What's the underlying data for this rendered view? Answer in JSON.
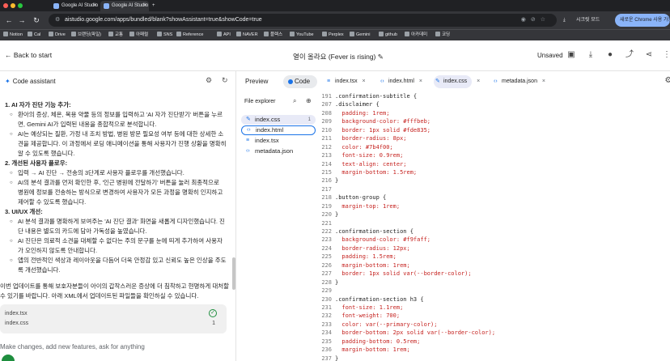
{
  "browser": {
    "tabs": [
      "Google AI Studio",
      "Google AI Studio"
    ],
    "url": "aistudio.google.com/apps/bundled/blank?showAssistant=true&showCode=true",
    "secret_mode": "시크릿 모드",
    "chrome_ad": "새로운 Chrome 사용 가능",
    "bookmarks": [
      "Notion",
      "Cal",
      "Drive",
      "브랜딩(파일)",
      "교통",
      "아패럴",
      "SNS",
      "Reference",
      "API",
      "NAVER",
      "플렉스",
      "YouTube",
      "Perplex",
      "Gemini",
      "github",
      "아카데미",
      "코딩"
    ]
  },
  "appbar": {
    "back_label": "Back to start",
    "title": "열이 올라요 (Fever is rising)",
    "unsaved": "Unsaved"
  },
  "assistant": {
    "title": "Code assistant",
    "lines": [
      {
        "kind": "h",
        "text": "1. AI 자가 진단 기능 추가:"
      },
      {
        "kind": "s",
        "text": "환아의 증상, 체온, 복용 약물 등의 정보를 입력하고 'AI 자가 진단받기' 버튼을 누르"
      },
      {
        "kind": "c",
        "text": "면, Gemini AI가 입력된 내용을 종합적으로 분석합니다."
      },
      {
        "kind": "s",
        "text": "AI는 예상되는 질환, 가정 내 조치 방법, 병원 방문 필요성 여부 등에 대한 상세한 소"
      },
      {
        "kind": "c",
        "text": "견을 제공합니다. 이 과정에서 로딩 애니메이션을 통해 사용자가 진행 상황을 명확히"
      },
      {
        "kind": "c",
        "text": "알 수 있도록 했습니다."
      },
      {
        "kind": "h",
        "text": "2. 개선된 사용자 플로우:"
      },
      {
        "kind": "s",
        "text": "입력 → AI 진단 → 전송의 3단계로 사용자 플로우를 개선했습니다."
      },
      {
        "kind": "s",
        "text": "AI의 분석 결과를 먼저 확인한 후, '인근 병원에 전달하기' 버튼을 눌러 최종적으로"
      },
      {
        "kind": "c",
        "text": "병원에 정보를 전송하는 방식으로 변경하여 사용자가 모든 과정을 명확히 인지하고"
      },
      {
        "kind": "c",
        "text": "제어할 수 있도록 했습니다."
      },
      {
        "kind": "h",
        "text": "3. UI/UX 개선:"
      },
      {
        "kind": "s",
        "text": "AI 분석 결과를 명확하게 보여주는 'AI 진단 결과' 화면을 새롭게 디자인했습니다. 진"
      },
      {
        "kind": "c",
        "text": "단 내용은 별도의 카드에 담아 가독성을 높였습니다."
      },
      {
        "kind": "s",
        "text": "AI 진단은 의료적 소견을 대체할 수 없다는 주의 문구를 눈에 띄게 추가하여 사용자"
      },
      {
        "kind": "c",
        "text": "가 오인하지 않도록 안내합니다."
      },
      {
        "kind": "s",
        "text": "앱의 전반적인 색상과 레이아웃을 다듬어 더욱 안정감 있고 신뢰도 높은 인상을 주도"
      },
      {
        "kind": "c",
        "text": "록 개선했습니다."
      },
      {
        "kind": "b",
        "text": ""
      },
      {
        "kind": "p",
        "text": "이번 업데이트를 통해 보호자분들이 아이의 갑작스러운 증상에 더 침착하고 현명하게 대처할"
      },
      {
        "kind": "p",
        "text": "수 있기를 바랍니다. 아래 XML에서 업데이트된 파일들을 확인하실 수 있습니다."
      }
    ],
    "files": [
      "index.tsx",
      "index.css"
    ],
    "files_count": "1",
    "input_placeholder": "Make changes, add new features, ask for anything"
  },
  "code_panel": {
    "preview_label": "Preview",
    "code_label": "Code",
    "tabs": [
      "index.tsx",
      "index.html",
      "index.css",
      "metadata.json"
    ],
    "explorer_title": "File explorer",
    "explorer_items": [
      "index.css",
      "index.html",
      "index.tsx",
      "metadata.json"
    ],
    "explorer_badge": "1",
    "code_lines": [
      {
        "n": "191",
        "t": ".confirmation-subtitle {"
      },
      {
        "n": "207",
        "t": ".disclaimer {"
      },
      {
        "n": "208",
        "t": "  padding: 1rem;"
      },
      {
        "n": "209",
        "t": "  background-color: #fffbeb;"
      },
      {
        "n": "210",
        "t": "  border: 1px solid #fde835;"
      },
      {
        "n": "211",
        "t": "  border-radius: 8px;"
      },
      {
        "n": "212",
        "t": "  color: #7b4f00;"
      },
      {
        "n": "213",
        "t": "  font-size: 0.9rem;"
      },
      {
        "n": "214",
        "t": "  text-align: center;"
      },
      {
        "n": "215",
        "t": "  margin-bottom: 1.5rem;"
      },
      {
        "n": "216",
        "t": "}"
      },
      {
        "n": "217",
        "t": ""
      },
      {
        "n": "218",
        "t": ".button-group {"
      },
      {
        "n": "219",
        "t": "  margin-top: 1rem;"
      },
      {
        "n": "220",
        "t": "}"
      },
      {
        "n": "221",
        "t": ""
      },
      {
        "n": "222",
        "t": ".confirmation-section {"
      },
      {
        "n": "223",
        "t": "  background-color: #f9faff;"
      },
      {
        "n": "224",
        "t": "  border-radius: 12px;"
      },
      {
        "n": "225",
        "t": "  padding: 1.5rem;"
      },
      {
        "n": "226",
        "t": "  margin-bottom: 1rem;"
      },
      {
        "n": "227",
        "t": "  border: 1px solid var(--border-color);"
      },
      {
        "n": "228",
        "t": "}"
      },
      {
        "n": "229",
        "t": ""
      },
      {
        "n": "230",
        "t": ".confirmation-section h3 {"
      },
      {
        "n": "231",
        "t": "  font-size: 1.1rem;"
      },
      {
        "n": "232",
        "t": "  font-weight: 700;"
      },
      {
        "n": "233",
        "t": "  color: var(--primary-color);"
      },
      {
        "n": "234",
        "t": "  border-bottom: 2px solid var(--border-color);"
      },
      {
        "n": "235",
        "t": "  padding-bottom: 0.5rem;"
      },
      {
        "n": "236",
        "t": "  margin-bottom: 1rem;"
      },
      {
        "n": "237",
        "t": "}"
      },
      {
        "n": "238",
        "t": ""
      }
    ]
  },
  "colors": {
    "accent": "#1a73e8",
    "success": "#1e8e3e",
    "code_prop": "#c5221f"
  }
}
